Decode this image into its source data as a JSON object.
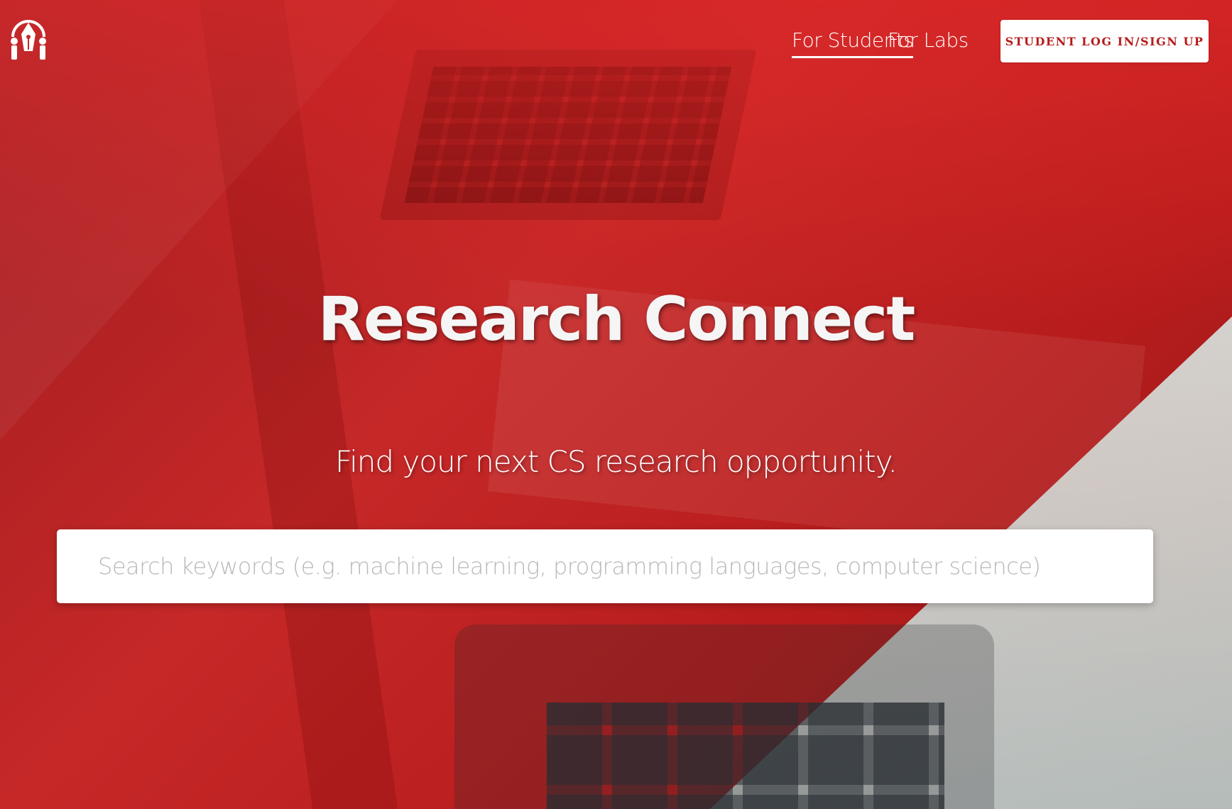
{
  "colors": {
    "brand_red": "#c62828",
    "button_text": "#b71c1c",
    "white": "#ffffff",
    "placeholder_gray": "#b8b8b8"
  },
  "header": {
    "logo_icon": "pen-nib-people-logo",
    "nav": [
      {
        "label": "For Students",
        "active": true
      },
      {
        "label": "For Labs",
        "active": false
      }
    ],
    "login_button": "STUDENT LOG IN/SIGN UP"
  },
  "hero": {
    "title": "Research Connect",
    "subtitle": "Find your next CS research opportunity.",
    "search": {
      "value": "",
      "placeholder": "Search keywords (e.g. machine learning, programming languages, computer science)"
    }
  }
}
